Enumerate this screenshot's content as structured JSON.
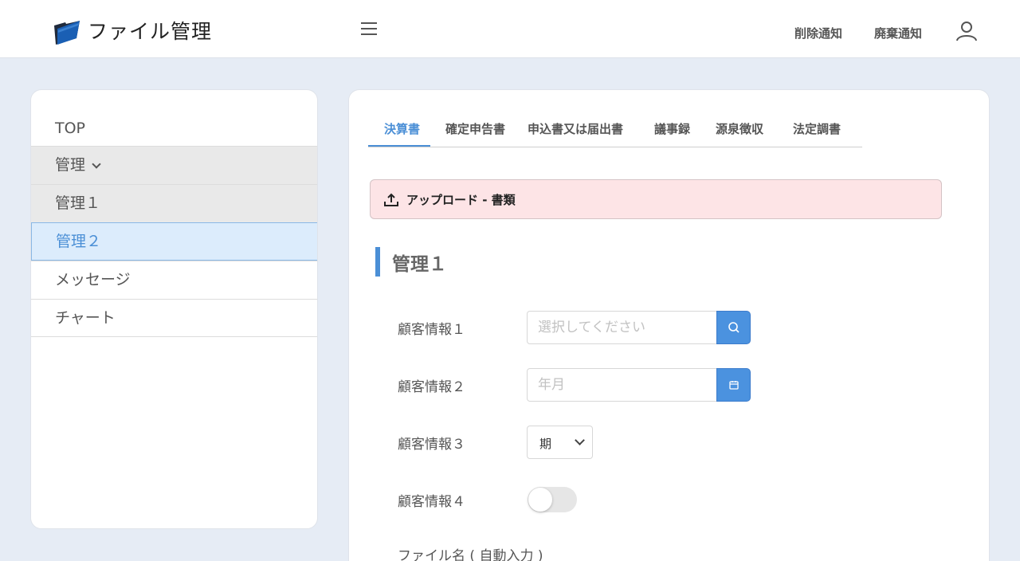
{
  "header": {
    "app_title": "ファイル管理",
    "links": [
      "削除通知",
      "廃棄通知"
    ],
    "icons": {
      "logo": "folder-logo-icon",
      "menu": "hamburger-menu-icon",
      "user": "user-icon"
    },
    "colors": {
      "logo_blue": "#1a5fb4",
      "logo_dark": "#1f2a3c"
    }
  },
  "sidebar": {
    "top_label": "TOP",
    "items": [
      {
        "label": "管理",
        "state": "expanded"
      },
      {
        "label": "管理１",
        "state": "normal"
      },
      {
        "label": "管理２",
        "state": "selected"
      },
      {
        "label": "メッセージ",
        "state": "normal"
      },
      {
        "label": "チャート",
        "state": "normal"
      }
    ]
  },
  "main": {
    "tabs": [
      {
        "label": "決算書",
        "active": true
      },
      {
        "label": "確定申告書",
        "active": false
      },
      {
        "label": "申込書又は届出書",
        "active": false
      },
      {
        "label": "議事録",
        "active": false
      },
      {
        "label": "源泉徴収",
        "active": false
      },
      {
        "label": "法定調書",
        "active": false
      }
    ],
    "upload": {
      "label": "アップロード - 書類",
      "icon": "upload-icon"
    },
    "section_title": "管理１",
    "fields": [
      {
        "label": "顧客情報１",
        "value": "",
        "placeholder": "選択してください",
        "icon": "search-icon"
      },
      {
        "label": "顧客情報２",
        "value": "",
        "placeholder": "年月",
        "icon": "calendar-icon"
      },
      {
        "label": "顧客情報３",
        "selected": "期"
      },
      {
        "label": "顧客情報４",
        "toggle_on": false
      },
      {
        "label": "ファイル名 ( 自動入力 )"
      }
    ],
    "colors": {
      "accent": "#4b8fd6",
      "upload_bg": "#fde4e6",
      "selected_bg": "#dcecfc"
    }
  }
}
